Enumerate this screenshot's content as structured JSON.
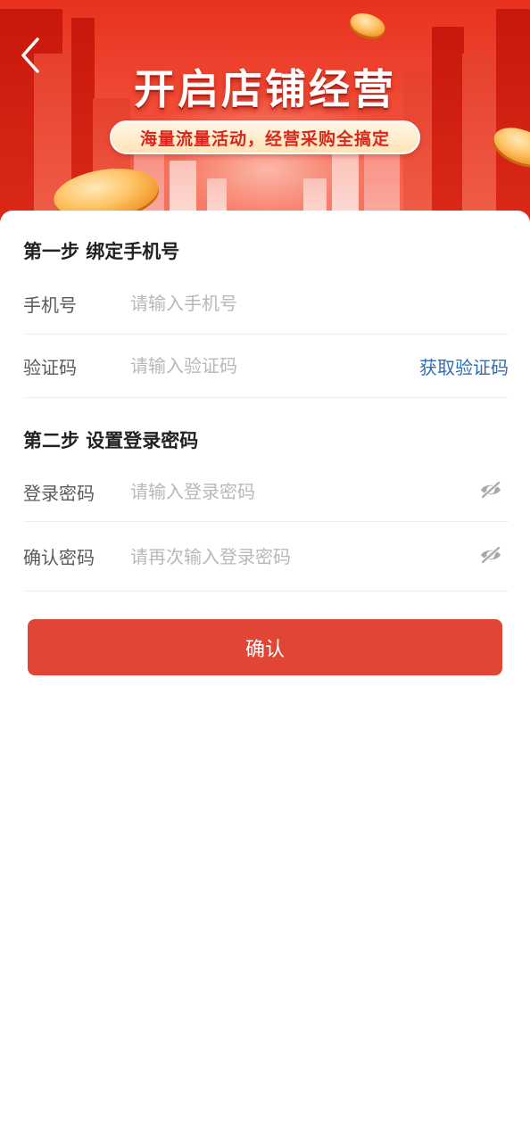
{
  "banner": {
    "title": "开启店铺经营",
    "subtitle": "海量流量活动，经营采购全搞定"
  },
  "step1": {
    "title": "第一步 绑定手机号",
    "phone": {
      "label": "手机号",
      "placeholder": "请输入手机号",
      "value": ""
    },
    "code": {
      "label": "验证码",
      "placeholder": "请输入验证码",
      "value": "",
      "action": "获取验证码"
    }
  },
  "step2": {
    "title": "第二步 设置登录密码",
    "password": {
      "label": "登录密码",
      "placeholder": "请输入登录密码",
      "value": ""
    },
    "confirm": {
      "label": "确认密码",
      "placeholder": "请再次输入登录密码",
      "value": ""
    }
  },
  "submit": {
    "label": "确认"
  },
  "icons": {
    "back": "chevron-left-icon",
    "visibility": "eye-off-icon"
  },
  "colors": {
    "brand": "#e04535",
    "link": "#2f6db5",
    "banner": "#e8321f"
  }
}
